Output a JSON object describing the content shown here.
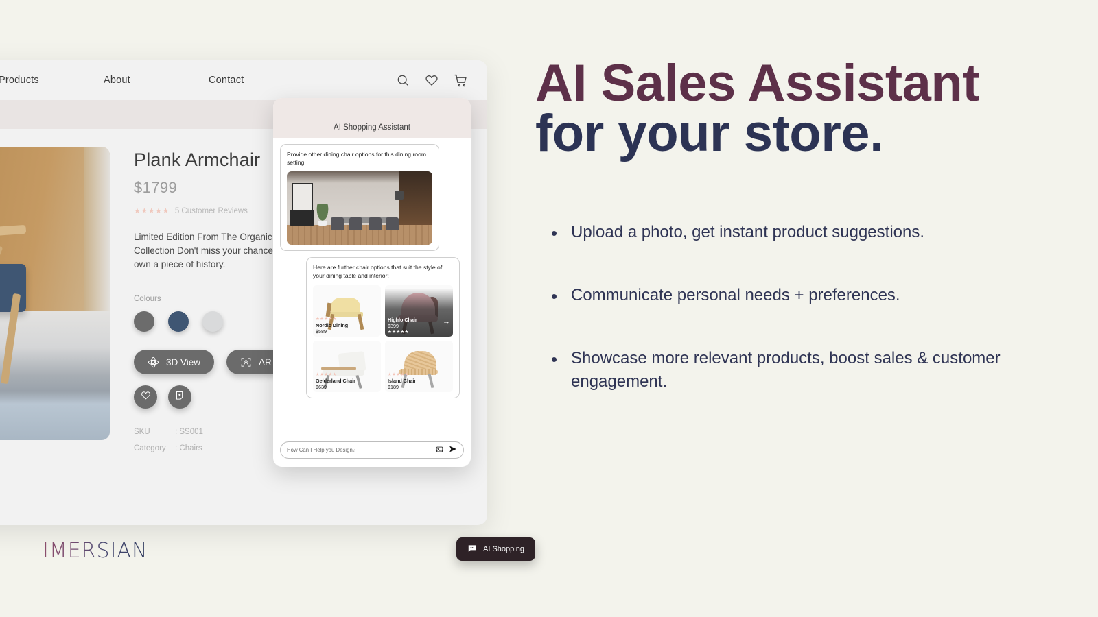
{
  "brand": {
    "logo_text": "IMERSIAN"
  },
  "marketing": {
    "headline_line1": "AI Sales Assistant",
    "headline_line2": "for your store.",
    "bullets": [
      "Upload a photo, get instant product suggestions.",
      "Communicate personal needs + preferences.",
      "Showcase more relevant products, boost sales & customer engagement."
    ]
  },
  "colors": {
    "page_bg": "#f3f3ec",
    "headline_plum": "#5d3049",
    "headline_navy": "#2c3354",
    "band": "#e9e4e3",
    "chat_header": "#efe8e6",
    "fab": "#2e2227",
    "button_gray": "#6b6b6b"
  },
  "store": {
    "nav": {
      "links": [
        "Products",
        "About",
        "Contact"
      ],
      "icons": [
        "search-icon",
        "heart-icon",
        "cart-icon"
      ]
    },
    "product": {
      "title": "Plank Armchair",
      "price": "$1799",
      "stars": "★★★★★",
      "reviews": "5 Customer Reviews",
      "description": "Limited Edition From The Organic Collection Don't miss your chance to own a piece of history.",
      "colours_label": "Colours",
      "swatches": [
        "#6c6c6c",
        "#3f5673",
        "#d9dadb"
      ],
      "view_3d_label": "3D View",
      "ar_label": "AR",
      "icon_buttons": [
        "heart-icon",
        "add-to-cart-icon"
      ],
      "meta": [
        {
          "key": "SKU",
          "value": ": SS001"
        },
        {
          "key": "Category",
          "value": ": Chairs"
        }
      ]
    }
  },
  "chat": {
    "title": "AI Shopping Assistant",
    "user_message": "Provide other dining chair options for this dining room setting:",
    "ai_message": "Here are further chair options that suit the style of your dining table and interior:",
    "products": [
      {
        "name": "Nordic Dining",
        "price": "$589",
        "stars": "★★★★★",
        "highlighted": false
      },
      {
        "name": "Highlo Chair",
        "price": "$399",
        "stars": "★★★★★",
        "highlighted": true
      },
      {
        "name": "Gelderland Chair",
        "price": "$639",
        "stars": "★★★★★",
        "highlighted": false
      },
      {
        "name": "Island Chair",
        "price": "$189",
        "stars": "★★★★★",
        "highlighted": false
      }
    ],
    "input_placeholder": "How Can I Help you Design?",
    "input_icons": [
      "image-icon",
      "send-icon"
    ],
    "fab_label": "AI Shopping",
    "fab_icon": "chat-bubble-icon"
  }
}
